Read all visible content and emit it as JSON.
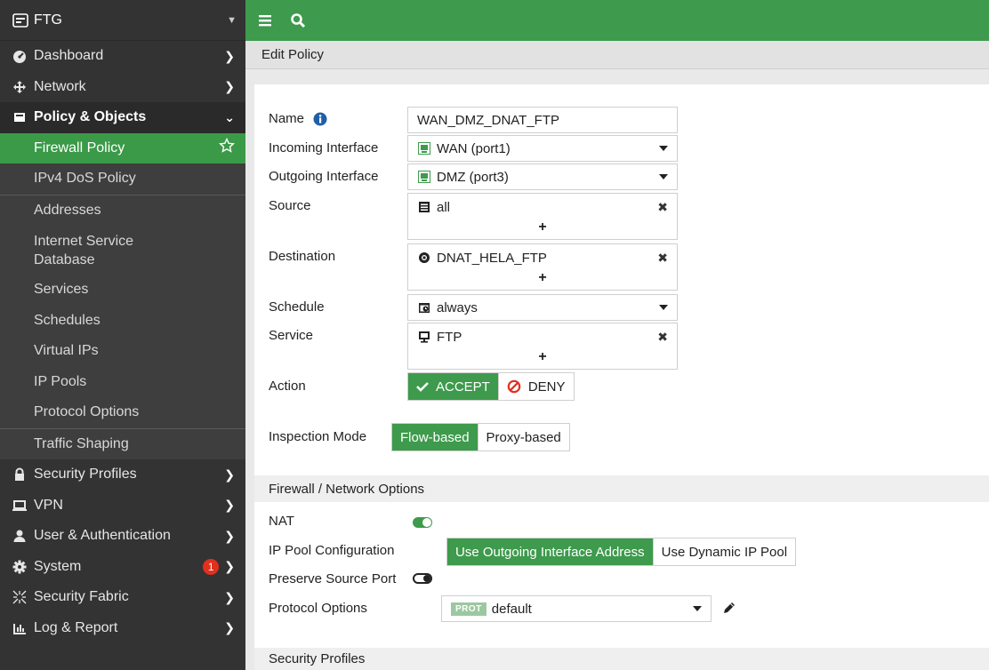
{
  "sidebar": {
    "device_name": "FTG",
    "items": [
      {
        "label": "Dashboard",
        "icon": "dashboard-icon"
      },
      {
        "label": "Network",
        "icon": "network-icon"
      },
      {
        "label": "Policy & Objects",
        "icon": "policy-icon",
        "expanded": true
      },
      {
        "label": "Security Profiles",
        "icon": "lock-icon"
      },
      {
        "label": "VPN",
        "icon": "vpn-icon"
      },
      {
        "label": "User & Authentication",
        "icon": "user-icon"
      },
      {
        "label": "System",
        "icon": "gear-icon",
        "badge": "1"
      },
      {
        "label": "Security Fabric",
        "icon": "fabric-icon"
      },
      {
        "label": "Log & Report",
        "icon": "chart-icon"
      }
    ],
    "policy_subitems": [
      {
        "label": "Firewall Policy",
        "active": true
      },
      {
        "label": "IPv4 DoS Policy"
      },
      {
        "label": "Addresses"
      },
      {
        "label": "Internet Service Database"
      },
      {
        "label": "Services"
      },
      {
        "label": "Schedules"
      },
      {
        "label": "Virtual IPs"
      },
      {
        "label": "IP Pools"
      },
      {
        "label": "Protocol Options"
      },
      {
        "label": "Traffic Shaping"
      }
    ]
  },
  "page_title": "Edit Policy",
  "form": {
    "name_label": "Name",
    "name_value": "WAN_DMZ_DNAT_FTP",
    "incoming_label": "Incoming Interface",
    "incoming_value": "WAN (port1)",
    "outgoing_label": "Outgoing Interface",
    "outgoing_value": "DMZ (port3)",
    "source_label": "Source",
    "source_value": "all",
    "destination_label": "Destination",
    "destination_value": "DNAT_HELA_FTP",
    "schedule_label": "Schedule",
    "schedule_value": "always",
    "service_label": "Service",
    "service_value": "FTP",
    "action_label": "Action",
    "accept_label": "ACCEPT",
    "deny_label": "DENY",
    "inspection_label": "Inspection Mode",
    "flow_label": "Flow-based",
    "proxy_label": "Proxy-based",
    "plus": "+",
    "remove": "✖"
  },
  "firewall_options": {
    "section_title": "Firewall / Network Options",
    "nat_label": "NAT",
    "nat_enabled": true,
    "ippool_label": "IP Pool Configuration",
    "use_outgoing_label": "Use Outgoing Interface Address",
    "use_dynamic_label": "Use Dynamic IP Pool",
    "preserve_label": "Preserve Source Port",
    "preserve_enabled": false,
    "protocol_label": "Protocol Options",
    "protocol_tag": "PROT",
    "protocol_value": "default"
  },
  "security_profiles": {
    "section_title": "Security Profiles"
  },
  "colors": {
    "accent": "#3e9a4c",
    "sidebar_bg": "#333333",
    "badge": "#e0301e"
  }
}
